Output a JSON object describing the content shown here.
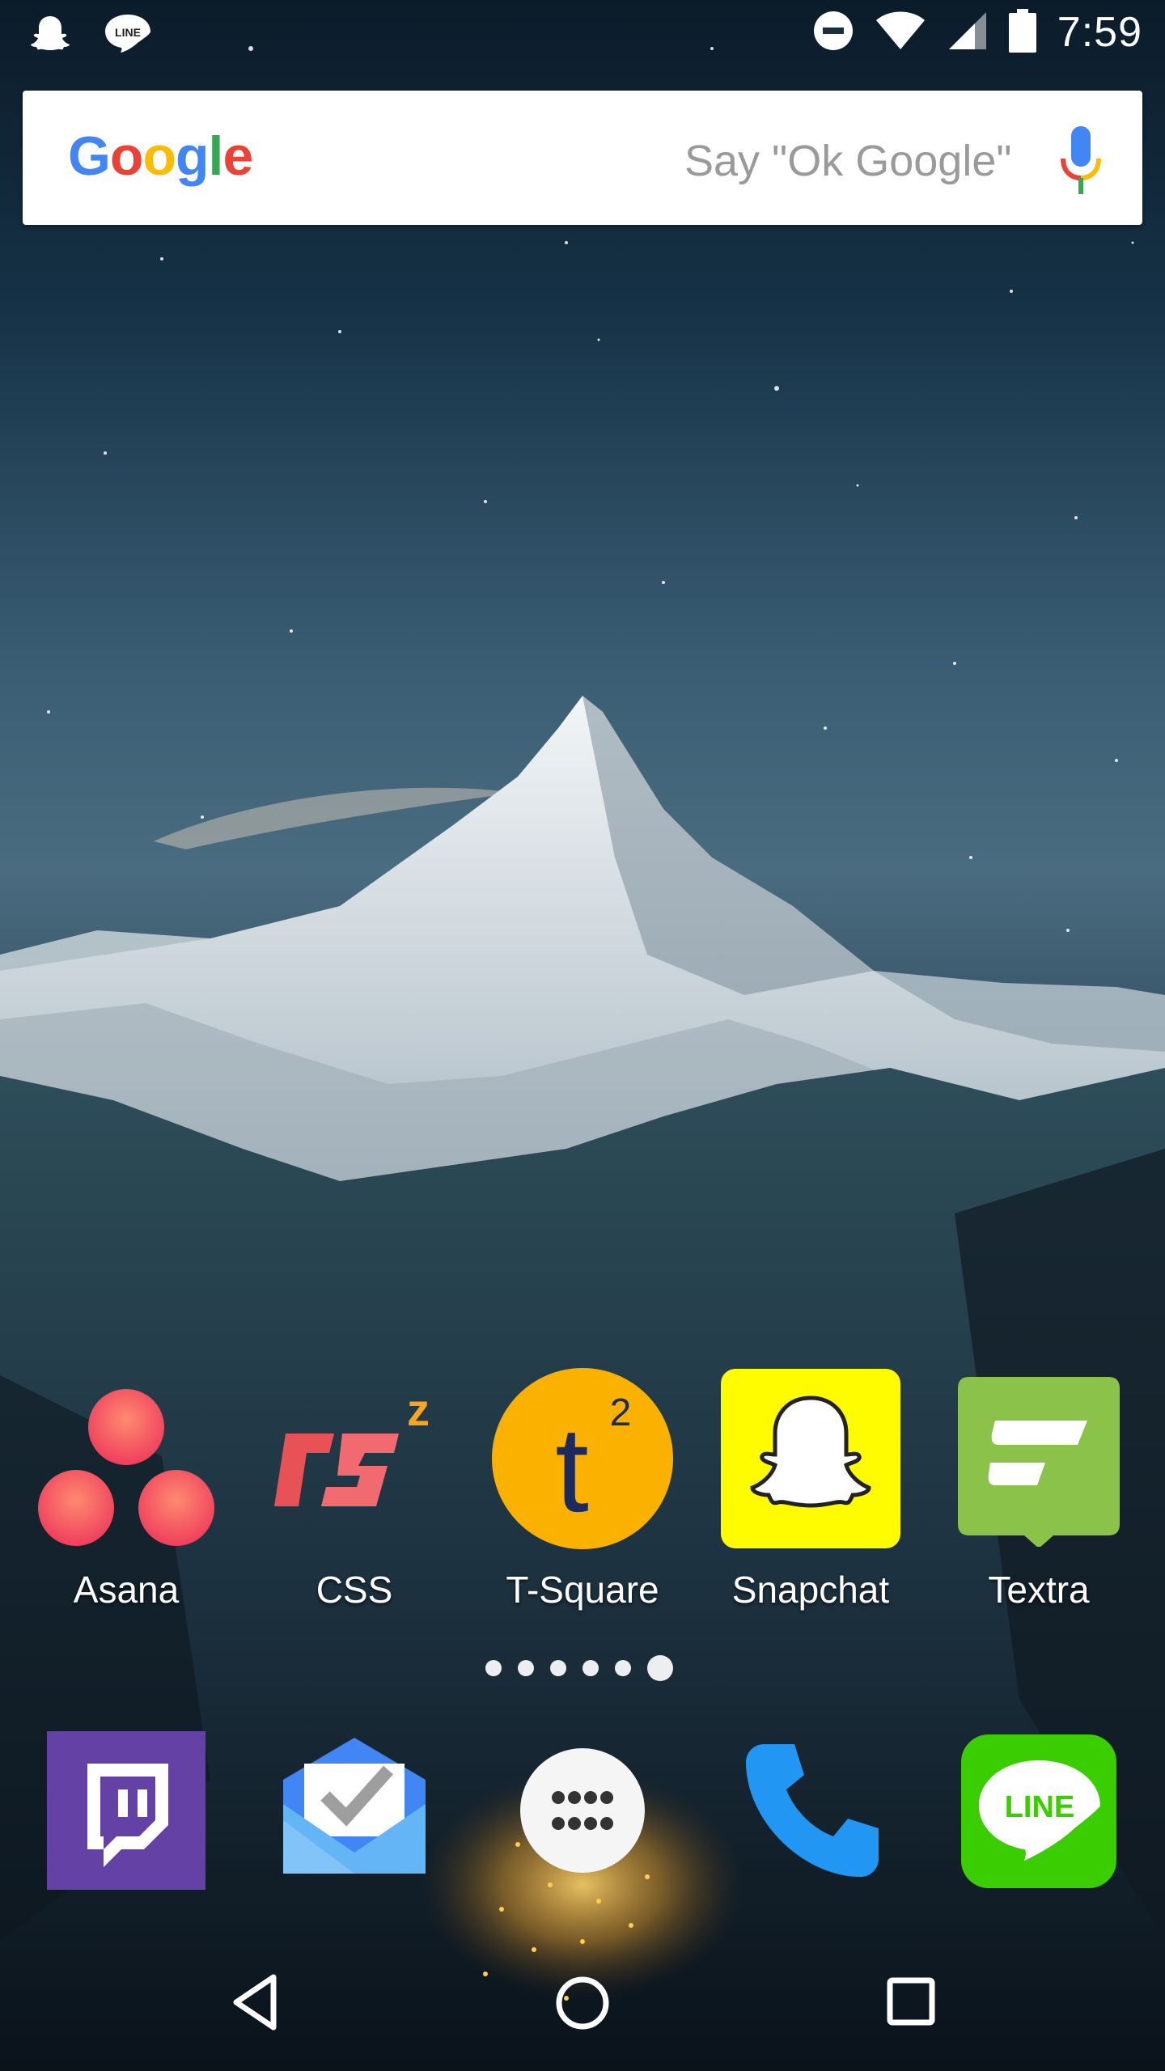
{
  "status_bar": {
    "time": "7:59",
    "left_icons": [
      "snapchat-ghost-icon",
      "line-icon"
    ],
    "right_icons": [
      "do-not-disturb-icon",
      "wifi-icon",
      "cellular-signal-icon",
      "battery-icon"
    ]
  },
  "search": {
    "logo_letters": [
      {
        "ch": "G",
        "color": "#4285F4"
      },
      {
        "ch": "o",
        "color": "#EA4335"
      },
      {
        "ch": "o",
        "color": "#FBBC05"
      },
      {
        "ch": "g",
        "color": "#4285F4"
      },
      {
        "ch": "l",
        "color": "#34A853"
      },
      {
        "ch": "e",
        "color": "#EA4335"
      }
    ],
    "hint": "Say \"Ok Google\"",
    "mic_icon": "microphone-icon"
  },
  "apps": [
    {
      "label": "Asana",
      "icon": "asana-icon",
      "color": "#f06a6a"
    },
    {
      "label": "CSS",
      "icon": "css-zz-icon",
      "color": "#e8535a"
    },
    {
      "label": "T-Square",
      "icon": "t-square-icon",
      "color": "#fbb100"
    },
    {
      "label": "Snapchat",
      "icon": "snapchat-icon",
      "color": "#fffc00"
    },
    {
      "label": "Textra",
      "icon": "textra-icon",
      "color": "#8bc34a"
    }
  ],
  "pager": {
    "pages": 6,
    "current": 6
  },
  "dock": [
    {
      "icon": "twitch-icon",
      "color": "#6441a4"
    },
    {
      "icon": "inbox-icon",
      "color": "#4285f4"
    },
    {
      "icon": "app-drawer-icon",
      "color": "#ffffff"
    },
    {
      "icon": "phone-icon",
      "color": "#2196f3"
    },
    {
      "icon": "line-icon",
      "color": "#3acd01"
    }
  ],
  "nav": {
    "back": "back-icon",
    "home": "home-icon",
    "recents": "recents-icon"
  },
  "colors": {
    "snapchat": "#FFFC00",
    "line": "#00C300",
    "asana": "#F06A6A"
  }
}
